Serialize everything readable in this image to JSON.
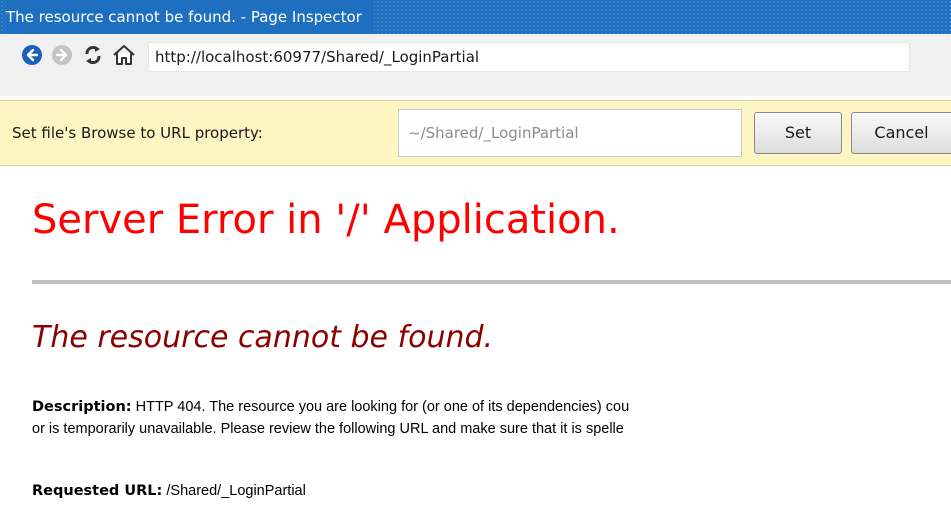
{
  "window": {
    "title": "The resource cannot be found. - Page Inspector"
  },
  "nav": {
    "back_icon": "back-arrow-icon",
    "forward_icon": "forward-arrow-icon",
    "refresh_icon": "refresh-icon",
    "home_icon": "home-icon",
    "url": "http://localhost:60977/Shared/_LoginPartial"
  },
  "browse_bar": {
    "label": "Set file's Browse to URL property:",
    "input_value": "~/Shared/_LoginPartial",
    "set_label": "Set",
    "cancel_label": "Cancel",
    "background": "#fdf6c3"
  },
  "page": {
    "error_title": "Server Error in '/' Application.",
    "error_subtitle": "The resource cannot be found.",
    "description_label": "Description:",
    "description_line1": "HTTP 404. The resource you are looking for (or one of its dependencies) cou",
    "description_line2": "or is temporarily unavailable.  Please review the following URL and make sure that it is spelle",
    "requested_url_label": "Requested URL:",
    "requested_url_value": "/Shared/_LoginPartial"
  },
  "colors": {
    "titlebar": "#1f6fc0",
    "error_title": "#ff0000",
    "error_subtitle": "#8b0000"
  }
}
